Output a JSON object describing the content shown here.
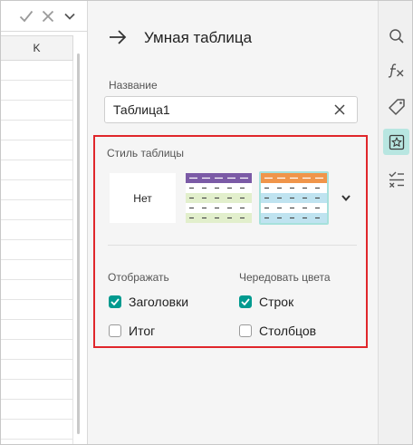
{
  "sheet": {
    "column_header": "K"
  },
  "formula_bar": {
    "icons": [
      "check-icon",
      "cancel-icon",
      "chevron-down-icon"
    ]
  },
  "panel": {
    "title": "Умная таблица",
    "name_label": "Название",
    "name_value": "Таблица1",
    "style_label": "Стиль таблицы",
    "style_none": "Нет",
    "show_label": "Отображать",
    "alternate_label": "Чередовать цвета",
    "options": {
      "headers": {
        "label": "Заголовки",
        "checked": true
      },
      "total": {
        "label": "Итог",
        "checked": false
      },
      "rows": {
        "label": "Строк",
        "checked": true
      },
      "columns": {
        "label": "Столбцов",
        "checked": false
      }
    }
  },
  "styles": [
    {
      "id": "none",
      "label": "Нет"
    },
    {
      "id": "purple-green",
      "header_color": "#7b5aa6",
      "band_color": "#e2efcc",
      "selected": false
    },
    {
      "id": "orange-blue",
      "header_color": "#f0954a",
      "band_color": "#bfe3f0",
      "selected": true
    }
  ],
  "toolbar": {
    "items": [
      {
        "icon": "search-icon",
        "active": false
      },
      {
        "icon": "function-icon",
        "active": false
      },
      {
        "icon": "tag-icon",
        "active": false
      },
      {
        "icon": "star-icon",
        "active": true
      },
      {
        "icon": "clear-list-icon",
        "active": false
      }
    ]
  },
  "colors": {
    "accent": "#009a8f",
    "highlight_border": "#e0262b",
    "selected_swatch_border": "#a6e1dc",
    "active_tool_bg": "#b8e6e1"
  }
}
